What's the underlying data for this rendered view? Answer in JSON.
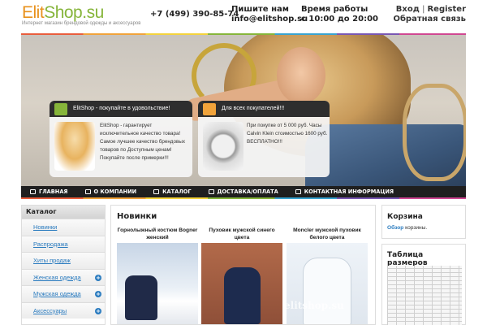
{
  "header": {
    "logo_part1": "Elit",
    "logo_part2": "Shop.su",
    "tagline": "Интернет магазин брендовой одежды и аксессуаров",
    "phone": "+7 (499) 390-85-74",
    "mail_label": "Пишите нам",
    "mail_value": "info@elitshop.su",
    "hours_label": "Время работы",
    "hours_value": "с 10:00 до 20:00",
    "login": "Вход",
    "register": "Register",
    "feedback": "Обратная связь"
  },
  "promos": [
    {
      "title": "ElitShop - покупайте в удовольствие!",
      "text": "ElitShop - гарантирует исключительное качество товара! Самое лучшее качество брендовых товаров по Доступным ценам! Покупайте после примерки!!!"
    },
    {
      "title": "Для всех покупателей!!!",
      "text": "При покупке от 5 000 руб. Часы Calvin Klein стоимостью 1600 руб. ВЕСПЛАТНО!!!"
    }
  ],
  "nav": [
    {
      "label": "ГЛАВНАЯ",
      "icon": "home-icon"
    },
    {
      "label": "О КОМПАНИИ",
      "icon": "users-icon"
    },
    {
      "label": "КАТАЛОГ",
      "icon": "catalog-icon"
    },
    {
      "label": "ДОСТАВКА/ОПЛАТА",
      "icon": "truck-icon"
    },
    {
      "label": "КОНТАКТНАЯ ИНФОРМАЦИЯ",
      "icon": "mail-icon"
    }
  ],
  "catalog": {
    "title": "Каталог",
    "items": [
      {
        "label": "Новинки",
        "has_sub": false
      },
      {
        "label": "Распродажа",
        "has_sub": false
      },
      {
        "label": "Хиты продаж",
        "has_sub": false
      },
      {
        "label": "Женская одежда",
        "has_sub": true
      },
      {
        "label": "Мужская одежда",
        "has_sub": true
      },
      {
        "label": "Аксессуары",
        "has_sub": true
      }
    ]
  },
  "main": {
    "title": "Новинки",
    "products": [
      {
        "name": "Горнолыжный костюм Bogner женский"
      },
      {
        "name": "Пуховик мужской синего цвета"
      },
      {
        "name": "Moncler мужской пуховик белого цвета"
      }
    ],
    "watermark": "elitshop.su"
  },
  "cart": {
    "title": "Корзина",
    "link": "Обзор",
    "text": " корзины."
  },
  "sizes": {
    "title": "Таблица размеров"
  },
  "colors": {
    "accent_orange": "#e8911c",
    "accent_green": "#86b53a",
    "link_blue": "#2a7bbf",
    "nav_bg": "#1f1f1f"
  }
}
